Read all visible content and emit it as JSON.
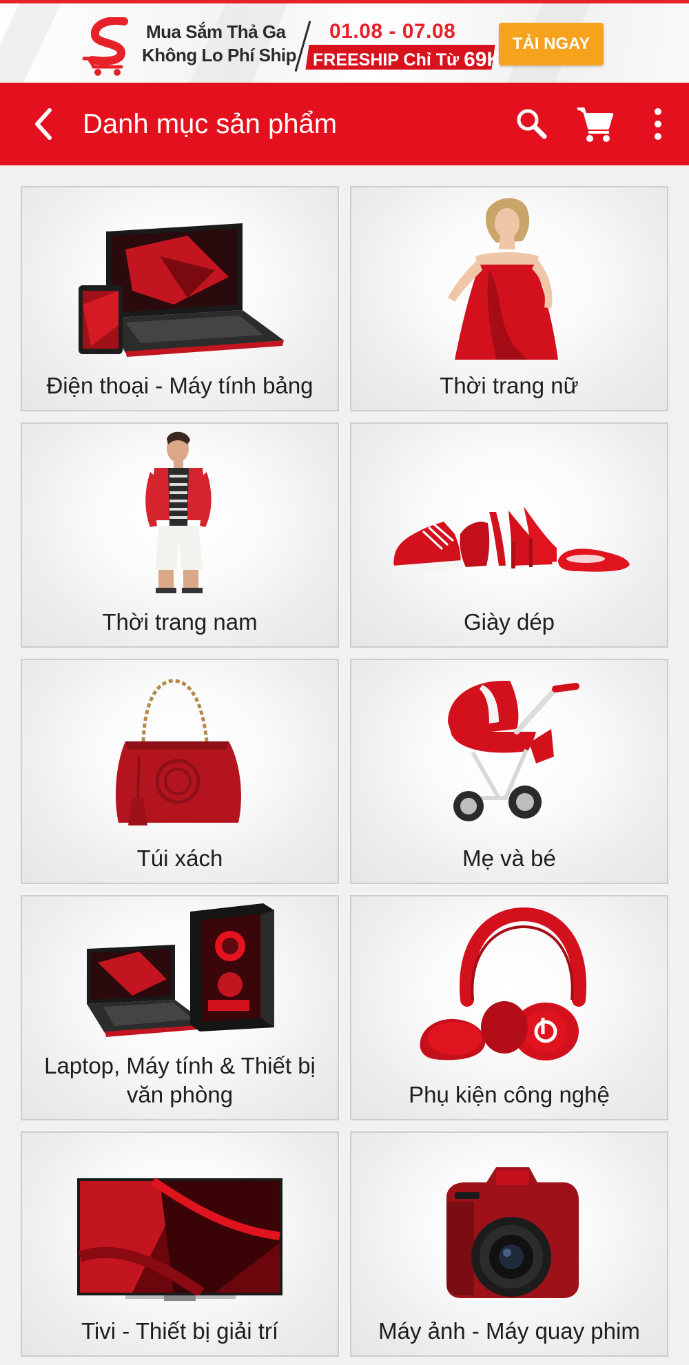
{
  "promo": {
    "line1": "Mua Sắm Thả Ga",
    "line2": "Không Lo Phí Ship",
    "dates": "01.08 - 07.08",
    "freeship_label": "FREESHIP Chỉ Từ",
    "freeship_amount": "69K",
    "download_label": "TẢI NGAY"
  },
  "appbar": {
    "title": "Danh mục sản phẩm"
  },
  "colors": {
    "brand_red": "#e5101d",
    "promo_orange": "#f6a21d"
  },
  "categories": [
    {
      "label": "Điện thoại - Máy tính bảng",
      "icon": "laptop-phone-icon"
    },
    {
      "label": "Thời trang nữ",
      "icon": "woman-fashion-icon"
    },
    {
      "label": "Thời trang nam",
      "icon": "man-fashion-icon"
    },
    {
      "label": "Giày dép",
      "icon": "shoes-icon"
    },
    {
      "label": "Túi xách",
      "icon": "handbag-icon"
    },
    {
      "label": "Mẹ và bé",
      "icon": "stroller-icon"
    },
    {
      "label": "Laptop, Máy tính & Thiết bị văn phòng",
      "icon": "computer-icon"
    },
    {
      "label": "Phụ kiện công nghệ",
      "icon": "headphones-icon"
    },
    {
      "label": "Tivi - Thiết bị giải trí",
      "icon": "tv-icon"
    },
    {
      "label": "Máy ảnh - Máy quay phim",
      "icon": "camera-icon"
    }
  ]
}
